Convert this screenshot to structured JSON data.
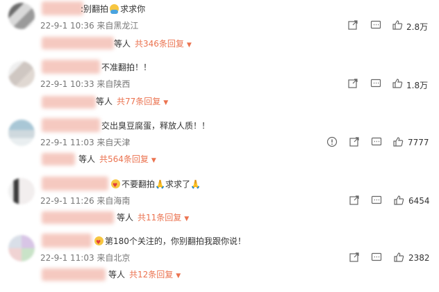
{
  "comments": [
    {
      "text": "别翻拍",
      "text_tail": "求求你",
      "meta": "22-9-1 10:36 来自黑龙江",
      "reply_who": "等人",
      "reply_count": "共346条回复",
      "likes": "2.8万"
    },
    {
      "text": "不准翻拍！！",
      "meta": "22-9-1 10:33 来自陕西",
      "reply_who": "等人",
      "reply_count": "共77条回复",
      "likes": "1.8万"
    },
    {
      "text": "交出臭豆腐蛋，释放人质！！",
      "meta": "22-9-1 11:03 来自天津",
      "reply_who": "等人",
      "reply_count": "共564条回复",
      "likes": "7777"
    },
    {
      "text": "不要翻拍",
      "text_tail": "求求了",
      "meta": "22-9-1 11:26 来自海南",
      "reply_who": "等人",
      "reply_count": "共11条回复",
      "likes": "6454"
    },
    {
      "text": "第180个关注的，你别翻拍我跟你说！",
      "meta": "22-9-1 11:03 来自北京",
      "reply_who": "等人",
      "reply_count": "共12条回复",
      "likes": "2382"
    }
  ],
  "icons": {
    "share": "share-icon",
    "comment": "comment-icon",
    "like": "thumbs-up-icon",
    "report": "report-icon",
    "caret": "caret-down-icon"
  },
  "colors": {
    "accent": "#eb7350",
    "meta": "#777777"
  }
}
